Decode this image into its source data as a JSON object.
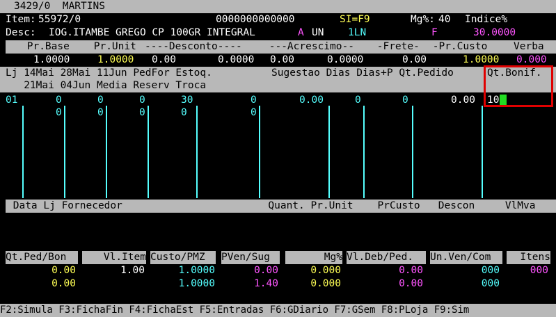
{
  "window": {
    "title": "3429/0  MARTINS"
  },
  "header": {
    "item_label": "Item:",
    "item_value": "55972/0",
    "code": "0000000000000",
    "si": "SI=F9",
    "mg_label": "Mg%:",
    "mg_value": "40",
    "indice": "Indice%",
    "desc_label": "Desc:",
    "desc_value": "IOG.ITAMBE GREGO CP 100GR INTEGRAL",
    "flag_a": "A",
    "unit": "UN",
    "lot": "1LN",
    "flag_f": "F",
    "indice_value": "30.0000"
  },
  "price": {
    "headers": [
      " Pr.Base",
      " Pr.Unit",
      "----Desconto----",
      " ---Acrescimo--",
      " -Frete-",
      " -Pr.Custo",
      "Verba"
    ],
    "pr_base": "1.0000",
    "pr_unit": "1.0000",
    "desconto": "0.00",
    "desconto2": "0.0000",
    "acrescimo": "0.00",
    "acrescimo2": "0.0000",
    "frete": "0.00",
    "pr_custo": "1.0000",
    "verba": "0.000"
  },
  "stock": {
    "header1": "Lj 14Mai 28Mai 11Jun PedFor Estoq.",
    "header1b": "Sugestao Dias Dias+P Qt.Pedido",
    "header_bonif": "Qt.Bonif.",
    "header2": "   21Mai 04Jun Media Reserv Troca",
    "row1": {
      "lj": "01",
      "v14": "0",
      "v28": "0",
      "v11": "0",
      "pedfor": "30",
      "estoq": "0",
      "sugestao": "0.00",
      "dias": "0",
      "diasp": "0",
      "qtpedido": "0.00",
      "qtbonif": "10"
    },
    "row2": {
      "v21": "0",
      "v04": "0",
      "media": "0",
      "reserv": "0",
      "troca": "0"
    }
  },
  "history": {
    "headers": " Data Lj Fornecedor                        Quant. Pr.Unit    PrCusto   Descon     VlMva"
  },
  "totals": {
    "headers": [
      "Qt.Ped/Bon",
      "Vl.Item",
      "Custo/PMZ",
      "PVen/Sug",
      "Mg%",
      "Vl.Deb/Ped.",
      "Un.Ven/Com",
      "Itens"
    ],
    "row1": [
      "0.00",
      "1.00",
      "1.0000",
      "0.00",
      "0.000",
      "0.00",
      "000",
      "000"
    ],
    "row2": [
      "0.00",
      "",
      "1.0000",
      "1.40",
      "0.000",
      "0.00",
      "000",
      ""
    ]
  },
  "fkeys": "F2:Simula F3:FichaFin F4:FichaEst F5:Entradas F6:GDiario F7:GSem F8:PLoja F9:Sim"
}
